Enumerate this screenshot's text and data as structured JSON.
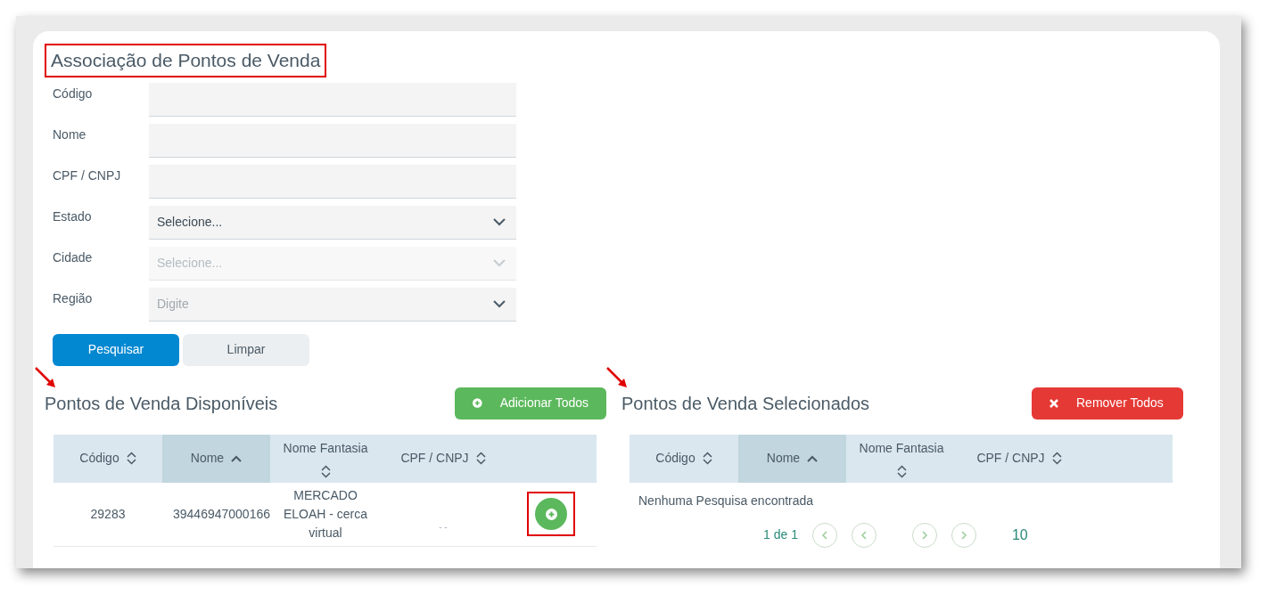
{
  "title": "Associação de Pontos de Venda",
  "form": [
    {
      "label": "Código",
      "kind": "text",
      "disabled": false
    },
    {
      "label": "Nome",
      "kind": "text",
      "disabled": false
    },
    {
      "label": "CPF / CNPJ",
      "kind": "text",
      "disabled": false
    },
    {
      "label": "Estado",
      "kind": "select",
      "value": "Selecione...",
      "disabled": false
    },
    {
      "label": "Cidade",
      "kind": "select",
      "placeholder": "Selecione...",
      "disabled": true
    },
    {
      "label": "Região",
      "kind": "select",
      "placeholder": "Digite",
      "disabled": false
    }
  ],
  "buttons": [
    {
      "label": "Pesquisar",
      "kind": "primary"
    },
    {
      "label": "Limpar",
      "kind": "secondary"
    }
  ],
  "available": {
    "title": "Pontos de Venda Disponíveis",
    "action": {
      "label": "Adicionar Todos",
      "kind": "add"
    },
    "columns": [
      {
        "label": "Código",
        "sorted": false
      },
      {
        "label": "Nome",
        "sorted": true
      },
      {
        "label": "Nome Fantasia",
        "sorted": false
      },
      {
        "label": "CPF / CNPJ",
        "sorted": false
      }
    ],
    "rows": [
      {
        "cells": [
          "29283",
          "39446947000166",
          "MERCADO ELOAH - cerca virtual",
          "- -"
        ]
      }
    ]
  },
  "selected": {
    "title": "Pontos de Venda Selecionados",
    "action": {
      "label": "Remover Todos",
      "kind": "remove"
    },
    "columns": [
      {
        "label": "Código",
        "sorted": false
      },
      {
        "label": "Nome",
        "sorted": true
      },
      {
        "label": "Nome Fantasia",
        "sorted": false
      },
      {
        "label": "CPF / CNPJ",
        "sorted": false
      }
    ],
    "empty": "Nenhuma Pesquisa encontrada",
    "pagination": {
      "range": "1 de 1",
      "page_size": "10"
    }
  }
}
